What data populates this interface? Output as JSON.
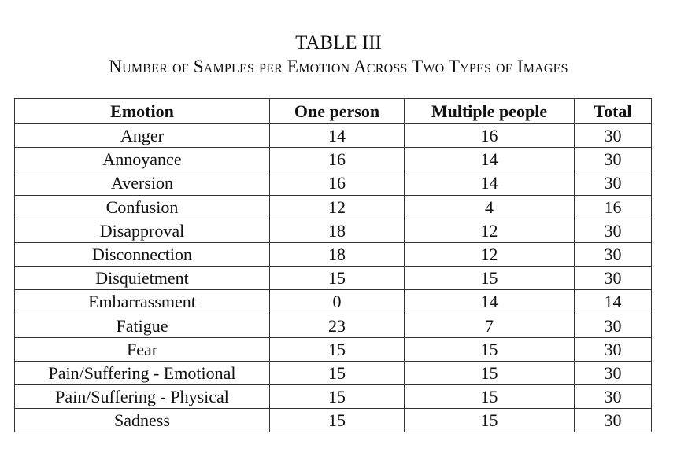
{
  "caption": {
    "label": "TABLE III",
    "title": "Number of Samples per Emotion Across Two Types of Images"
  },
  "table": {
    "headers": [
      "Emotion",
      "One person",
      "Multiple people",
      "Total"
    ],
    "rows": [
      [
        "Anger",
        "14",
        "16",
        "30"
      ],
      [
        "Annoyance",
        "16",
        "14",
        "30"
      ],
      [
        "Aversion",
        "16",
        "14",
        "30"
      ],
      [
        "Confusion",
        "12",
        "4",
        "16"
      ],
      [
        "Disapproval",
        "18",
        "12",
        "30"
      ],
      [
        "Disconnection",
        "18",
        "12",
        "30"
      ],
      [
        "Disquietment",
        "15",
        "15",
        "30"
      ],
      [
        "Embarrassment",
        "0",
        "14",
        "14"
      ],
      [
        "Fatigue",
        "23",
        "7",
        "30"
      ],
      [
        "Fear",
        "15",
        "15",
        "30"
      ],
      [
        "Pain/Suffering - Emotional",
        "15",
        "15",
        "30"
      ],
      [
        "Pain/Suffering - Physical",
        "15",
        "15",
        "30"
      ],
      [
        "Sadness",
        "15",
        "15",
        "30"
      ]
    ]
  }
}
